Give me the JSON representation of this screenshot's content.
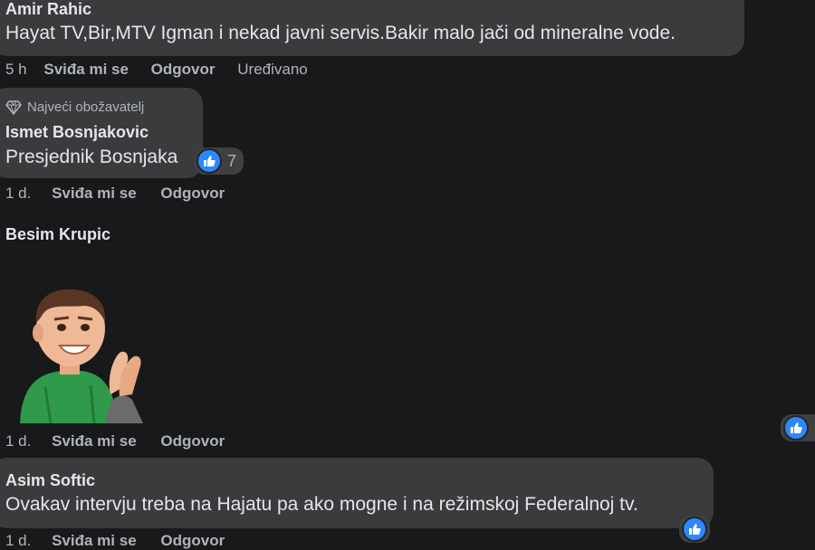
{
  "colors": {
    "background": "#18191a",
    "bubble": "#3a3b3c",
    "text": "#e4e6eb",
    "secondary": "#b0b3b8",
    "like_blue": "#2d88ff"
  },
  "comments": [
    {
      "author": "Amir Rahic",
      "text": "Hayat TV,Bir,MTV Igman i nekad javni servis.Bakir malo jači od mineralne vode.",
      "time": "5 h",
      "like_action": "Sviđa mi se",
      "reply_action": "Odgovor",
      "edited": "Uređivano"
    },
    {
      "badge": "Najveći obožavatelj",
      "badge_icon": "diamond-icon",
      "author": "Ismet Bosnjakovic",
      "text": "Presjednik Bosnjaka",
      "reaction_icon": "thumbs-up-icon",
      "reaction_count": "7",
      "time": "1 d.",
      "like_action": "Sviđa mi se",
      "reply_action": "Odgovor"
    },
    {
      "author": "Besim Krupic",
      "sticker": "clapping-avatar-sticker",
      "time": "1 d.",
      "like_action": "Sviđa mi se",
      "reply_action": "Odgovor",
      "reaction_icon": "thumbs-up-icon"
    },
    {
      "author": "Asim Softic",
      "text": "Ovakav intervju treba na Hajatu pa ako mogne i na režimskoj Federalnoj tv.",
      "time": "1 d.",
      "like_action": "Sviđa mi se",
      "reply_action": "Odgovor",
      "reaction_icon": "thumbs-up-icon"
    }
  ]
}
